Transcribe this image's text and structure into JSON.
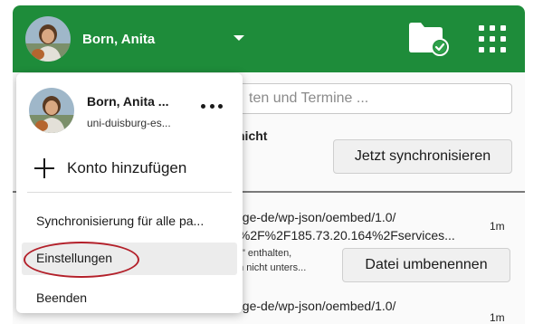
{
  "header": {
    "account_name": "Born, Anita",
    "avatar_icon": "user-avatar",
    "folder_icon": "folder-sync-ok-icon",
    "apps_icon": "app-grid-icon",
    "brand_color": "#1e8c3a"
  },
  "main": {
    "search_placeholder": "ten und Termine ...",
    "status_text": "nicht",
    "sync_button": "Jetzt synchronisieren",
    "activity": [
      {
        "line1": "age-de/wp-json/oembed/1.0/",
        "line2": ":%2F%2F185.73.20.164%2Fservices...",
        "time": "1m"
      },
      {
        "line1": "\":\" enthalten,",
        "line2": "m nicht unters...",
        "action": "Datei umbenennen"
      },
      {
        "line1": "age-de/wp-json/oembed/1.0/",
        "time": "1m"
      }
    ]
  },
  "menu": {
    "account_name": "Born, Anita ...",
    "server": "uni-duisburg-es...",
    "add_account": "Konto hinzufügen",
    "items": [
      {
        "label": "Synchronisierung für alle pa..."
      },
      {
        "label": "Einstellungen",
        "highlighted": true
      },
      {
        "label": "Beenden"
      }
    ],
    "highlight_color": "#b3202a"
  }
}
